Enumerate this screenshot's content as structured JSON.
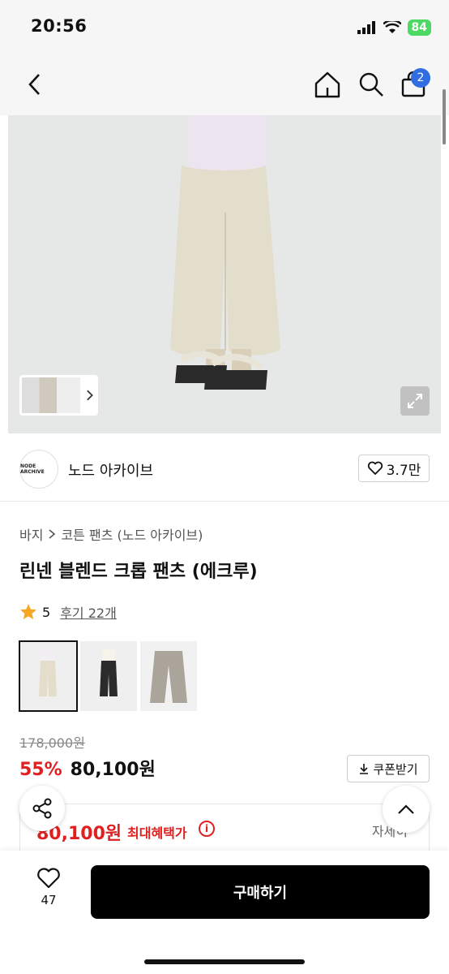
{
  "status": {
    "time": "20:56",
    "battery": "84"
  },
  "header": {
    "cart_count": "2"
  },
  "brand": {
    "logo_text": "NODE ARCHIVE",
    "name": "노드 아카이브",
    "likes": "3.7만"
  },
  "breadcrumb": {
    "category": "바지",
    "subcategory": "코튼 팬츠 (노드 아카이브)"
  },
  "product": {
    "title": "린넨 블렌드 크롭 팬츠 (에크루)",
    "rating": "5",
    "reviews": "후기 22개",
    "colors": [
      "ecru",
      "black",
      "gray"
    ]
  },
  "price": {
    "original": "178,000원",
    "discount": "55%",
    "sale": "80,100원",
    "coupon_label": "쿠폰받기"
  },
  "benefit": {
    "price": "80,100원",
    "label": "최대혜택가",
    "detail": "자세히"
  },
  "bottom": {
    "wish_count": "47",
    "buy_label": "구매하기"
  },
  "colors": {
    "accent_red": "#e02020",
    "badge_blue": "#2f6de1",
    "buy_black": "#000000"
  }
}
